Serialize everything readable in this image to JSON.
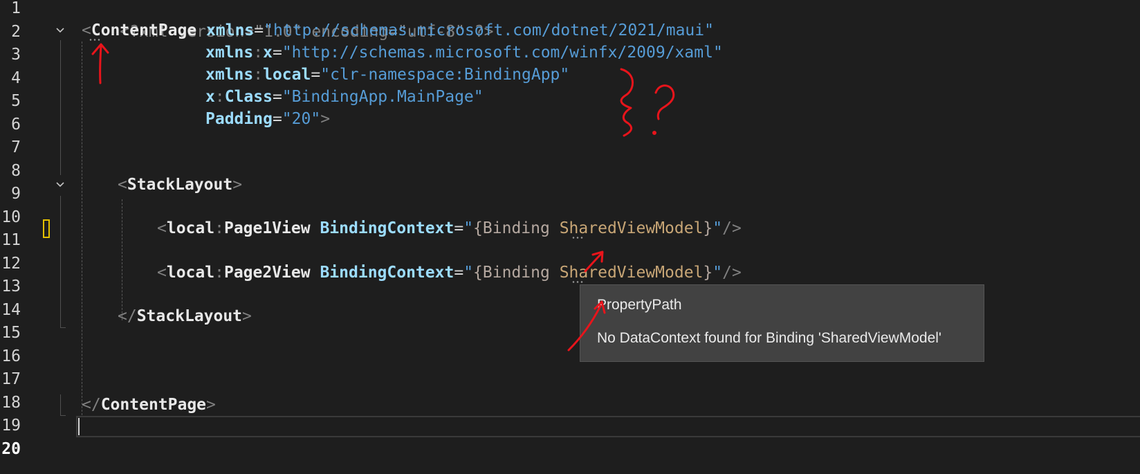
{
  "line_numbers": [
    "1",
    "2",
    "3",
    "4",
    "5",
    "6",
    "7",
    "8",
    "9",
    "10",
    "11",
    "12",
    "13",
    "14",
    "15",
    "16",
    "17",
    "18",
    "19",
    "20"
  ],
  "code": {
    "l1": "<?xml version=\"1.0\" encoding=\"utf-8\" ?>",
    "l2": {
      "lt": "<",
      "tag": "ContentPage",
      "attr": "xmlns",
      "eq": "=",
      "val": "\"http://schemas.microsoft.com/dotnet/2021/maui\""
    },
    "l3": {
      "prefix": "xmlns",
      "colon": ":",
      "name": "x",
      "eq": "=",
      "val": "\"http://schemas.microsoft.com/winfx/2009/xaml\""
    },
    "l4": {
      "prefix": "xmlns",
      "colon": ":",
      "name": "local",
      "eq": "=",
      "val": "\"clr-namespace:BindingApp\""
    },
    "l5": {
      "prefix": "x",
      "colon": ":",
      "name": "Class",
      "eq": "=",
      "val": "\"BindingApp.MainPage\""
    },
    "l6": {
      "name": "Padding",
      "eq": "=",
      "val": "\"20\"",
      "gt": ">"
    },
    "l9": {
      "lt": "<",
      "tag": "StackLayout",
      "gt": ">"
    },
    "l11": {
      "lt": "<",
      "ns": "local",
      "colon": ":",
      "tag": "Page1View",
      "attr": "BindingContext",
      "eq": "=",
      "q1": "\"",
      "brace": "{",
      "kw": "Binding",
      "path": "SharedViewModel",
      "close": "}",
      "q2": "\"",
      "end": "/>"
    },
    "l13": {
      "lt": "<",
      "ns": "local",
      "colon": ":",
      "tag": "Page2View",
      "attr": "BindingContext",
      "eq": "=",
      "q1": "\"",
      "brace": "{",
      "kw": "Binding",
      "path": "SharedViewModel",
      "close": "}",
      "q2": "\"",
      "end": "/>"
    },
    "l15": {
      "lt": "</",
      "tag": "StackLayout",
      "gt": ">"
    },
    "l19": {
      "lt": "</",
      "tag": "ContentPage",
      "gt": ">"
    }
  },
  "tooltip": {
    "title": "PropertyPath",
    "message": "No DataContext found for Binding 'SharedViewModel'"
  },
  "annotation": {
    "question_mark": "?",
    "color": "#e8141b"
  }
}
